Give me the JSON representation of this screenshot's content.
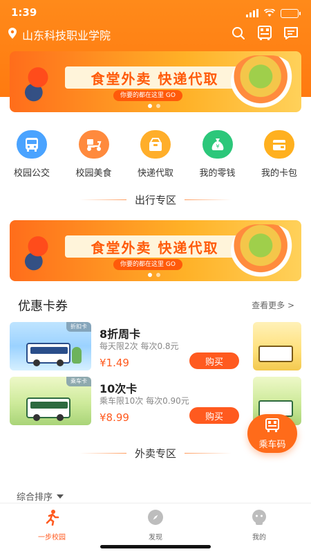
{
  "status_bar": {
    "time": "1:39"
  },
  "header": {
    "location": "山东科技职业学院",
    "accent_color": "#ff7a10"
  },
  "banners": [
    {
      "title": "食堂外卖 快递代取",
      "subtitle": "你要的都在这里 GO"
    },
    {
      "title": "食堂外卖 快递代取",
      "subtitle": "你要的都在这里 GO"
    }
  ],
  "quick_icons": [
    {
      "label": "校园公交",
      "icon": "bus-icon",
      "color": "#4aa3ff"
    },
    {
      "label": "校园美食",
      "icon": "scooter-icon",
      "color": "#ff8a3d"
    },
    {
      "label": "快递代取",
      "icon": "package-icon",
      "color": "#ffae2a"
    },
    {
      "label": "我的零钱",
      "icon": "money-bag-icon",
      "color": "#2cc77a"
    },
    {
      "label": "我的卡包",
      "icon": "wallet-icon",
      "color": "#ffb01f"
    }
  ],
  "sections": {
    "travel": "出行专区",
    "takeout": "外卖专区"
  },
  "coupons": {
    "title": "优惠卡券",
    "more": "查看更多 >",
    "cards": [
      {
        "tag": "折扣卡",
        "name": "8折周卡",
        "desc": "每天限2次 每次0.8元",
        "price": "¥1.49",
        "buy": "购买"
      },
      {
        "tag": "乘车卡",
        "name": "10次卡",
        "desc": "乘车限10次 每次0.90元",
        "price": "¥8.99",
        "buy": "购买"
      }
    ]
  },
  "fab": {
    "label": "乘车码"
  },
  "sort": {
    "label": "综合排序"
  },
  "tabbar": [
    {
      "label": "一步校园",
      "icon": "runner-icon",
      "active": true
    },
    {
      "label": "发现",
      "icon": "compass-icon",
      "active": false
    },
    {
      "label": "我的",
      "icon": "profile-icon",
      "active": false
    }
  ]
}
